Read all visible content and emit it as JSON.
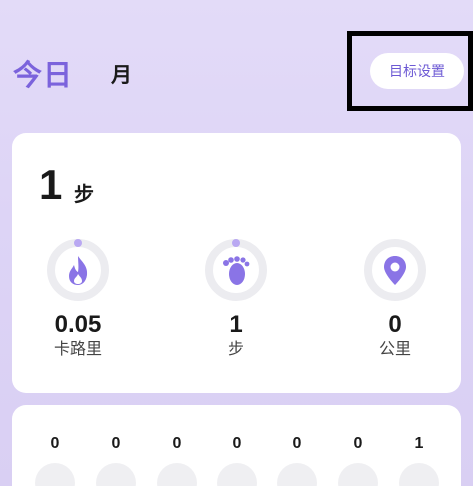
{
  "header": {
    "tabs": [
      {
        "label": "今日",
        "active": true
      },
      {
        "label": "月",
        "active": false
      }
    ],
    "goal_button": "目标设置"
  },
  "summary": {
    "steps_value": "1",
    "steps_unit": "步",
    "metrics": [
      {
        "icon": "flame-icon",
        "value": "0.05",
        "label": "卡路里",
        "progress": 0.0
      },
      {
        "icon": "footprint-icon",
        "value": "1",
        "label": "步",
        "progress": 0.0
      },
      {
        "icon": "location-pin-icon",
        "value": "0",
        "label": "公里",
        "progress": 0.0
      }
    ]
  },
  "week": {
    "day_values": [
      "0",
      "0",
      "0",
      "0",
      "0",
      "0",
      "1"
    ]
  },
  "colors": {
    "accent": "#7b63dc",
    "ring_track": "#ececf0",
    "ring_dot": "#b9a8f2",
    "icon_fill": "#8a74e6"
  }
}
